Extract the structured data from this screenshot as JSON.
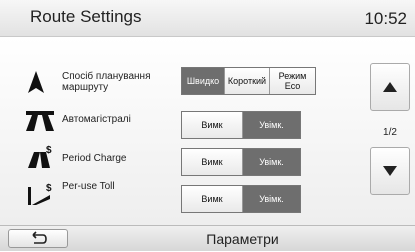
{
  "header": {
    "title": "Route Settings",
    "time": "10:52"
  },
  "rows": [
    {
      "label_line1": "Спосіб планування",
      "label_line2": "маршруту",
      "icon": "navigation-arrow-icon",
      "options": [
        {
          "label": "Швидко",
          "selected": true
        },
        {
          "label": "Короткий",
          "selected": false
        },
        {
          "label_line1": "Режим",
          "label_line2": "Eco",
          "selected": false
        }
      ]
    },
    {
      "label": "Автомагістралі",
      "icon": "highway-icon",
      "options": [
        {
          "label": "Вимк",
          "selected": false
        },
        {
          "label": "Увімк.",
          "selected": true
        }
      ]
    },
    {
      "label": "Period Charge",
      "icon": "toll-period-icon",
      "options": [
        {
          "label": "Вимк",
          "selected": false
        },
        {
          "label": "Увімк.",
          "selected": true
        }
      ]
    },
    {
      "label": "Per-use Toll",
      "icon": "toll-road-icon",
      "options": [
        {
          "label": "Вимк",
          "selected": false
        },
        {
          "label": "Увімк.",
          "selected": true
        }
      ]
    }
  ],
  "pager": {
    "text": "1/2"
  },
  "footer": {
    "title": "Параметри",
    "back_icon": "back-arrow-icon"
  },
  "colors": {
    "selected": "#6e6e6e",
    "background": "#ffffff"
  }
}
